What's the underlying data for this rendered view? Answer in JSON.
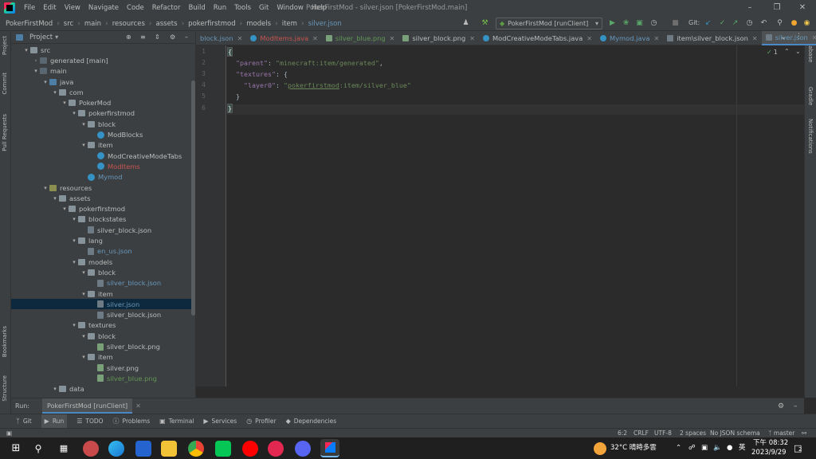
{
  "window": {
    "title": "PokerFirstMod - silver.json [PokerFirstMod.main]",
    "menus": [
      "File",
      "Edit",
      "View",
      "Navigate",
      "Code",
      "Refactor",
      "Build",
      "Run",
      "Tools",
      "Git",
      "Window",
      "Help"
    ]
  },
  "nav": {
    "breadcrumbs": [
      "PokerFirstMod",
      "src",
      "main",
      "resources",
      "assets",
      "pokerfirstmod",
      "models",
      "item",
      "silver.json"
    ],
    "run_config": "PokerFirstMod [runClient]",
    "git_label": "Git:"
  },
  "project": {
    "title": "Project",
    "tree": [
      {
        "label": "src",
        "depth": 1,
        "arrow": "v",
        "icon": "folder"
      },
      {
        "label": "generated [main]",
        "depth": 2,
        "arrow": ">",
        "icon": "gen"
      },
      {
        "label": "main",
        "depth": 2,
        "arrow": "v",
        "icon": "gen"
      },
      {
        "label": "java",
        "depth": 3,
        "arrow": "v",
        "icon": "folder-blue"
      },
      {
        "label": "com",
        "depth": 4,
        "arrow": "v",
        "icon": "folder"
      },
      {
        "label": "PokerMod",
        "depth": 5,
        "arrow": "v",
        "icon": "folder"
      },
      {
        "label": "pokerfirstmod",
        "depth": 6,
        "arrow": "v",
        "icon": "folder"
      },
      {
        "label": "block",
        "depth": 7,
        "arrow": "v",
        "icon": "folder"
      },
      {
        "label": "ModBlocks",
        "depth": 8,
        "arrow": "",
        "icon": "class"
      },
      {
        "label": "item",
        "depth": 7,
        "arrow": "v",
        "icon": "folder"
      },
      {
        "label": "ModCreativeModeTabs",
        "depth": 8,
        "arrow": "",
        "icon": "class"
      },
      {
        "label": "ModItems",
        "depth": 8,
        "arrow": "",
        "icon": "class",
        "color": "#c75450"
      },
      {
        "label": "Mymod",
        "depth": 7,
        "arrow": "",
        "icon": "class",
        "color": "#6897bb"
      },
      {
        "label": "resources",
        "depth": 3,
        "arrow": "v",
        "icon": "folder-res"
      },
      {
        "label": "assets",
        "depth": 4,
        "arrow": "v",
        "icon": "folder"
      },
      {
        "label": "pokerfirstmod",
        "depth": 5,
        "arrow": "v",
        "icon": "folder"
      },
      {
        "label": "blockstates",
        "depth": 6,
        "arrow": "v",
        "icon": "folder"
      },
      {
        "label": "silver_block.json",
        "depth": 7,
        "arrow": "",
        "icon": "json"
      },
      {
        "label": "lang",
        "depth": 6,
        "arrow": "v",
        "icon": "folder"
      },
      {
        "label": "en_us.json",
        "depth": 7,
        "arrow": "",
        "icon": "json",
        "color": "#6897bb"
      },
      {
        "label": "models",
        "depth": 6,
        "arrow": "v",
        "icon": "folder"
      },
      {
        "label": "block",
        "depth": 7,
        "arrow": "v",
        "icon": "folder"
      },
      {
        "label": "silver_block.json",
        "depth": 8,
        "arrow": "",
        "icon": "json",
        "color": "#6897bb"
      },
      {
        "label": "item",
        "depth": 7,
        "arrow": "v",
        "icon": "folder"
      },
      {
        "label": "silver.json",
        "depth": 8,
        "arrow": "",
        "icon": "json",
        "color": "#6897bb",
        "selected": true
      },
      {
        "label": "silver_block.json",
        "depth": 8,
        "arrow": "",
        "icon": "json"
      },
      {
        "label": "textures",
        "depth": 6,
        "arrow": "v",
        "icon": "folder"
      },
      {
        "label": "block",
        "depth": 7,
        "arrow": "v",
        "icon": "folder"
      },
      {
        "label": "silver_block.png",
        "depth": 8,
        "arrow": "",
        "icon": "img"
      },
      {
        "label": "item",
        "depth": 7,
        "arrow": "v",
        "icon": "folder"
      },
      {
        "label": "silver.png",
        "depth": 8,
        "arrow": "",
        "icon": "img"
      },
      {
        "label": "silver_blue.png",
        "depth": 8,
        "arrow": "",
        "icon": "img",
        "color": "#629755"
      },
      {
        "label": "data",
        "depth": 4,
        "arrow": "v",
        "icon": "folder"
      }
    ]
  },
  "tabs": [
    {
      "label": "block.json",
      "color": "#6897bb",
      "icon": "json"
    },
    {
      "label": "ModItems.java",
      "color": "#c75450",
      "icon": "class"
    },
    {
      "label": "silver_blue.png",
      "color": "#629755",
      "icon": "img"
    },
    {
      "label": "silver_block.png",
      "color": "#bbbbbb",
      "icon": "img"
    },
    {
      "label": "ModCreativeModeTabs.java",
      "color": "#bbbbbb",
      "icon": "class"
    },
    {
      "label": "Mymod.java",
      "color": "#6897bb",
      "icon": "class"
    },
    {
      "label": "item\\silver_block.json",
      "color": "#bbbbbb",
      "icon": "json"
    },
    {
      "label": "silver.json",
      "color": "#6897bb",
      "icon": "json",
      "active": true
    }
  ],
  "editor": {
    "line_numbers": [
      "1",
      "2",
      "3",
      "4",
      "5",
      "6"
    ],
    "code": {
      "l1": "{",
      "l2_key": "\"parent\"",
      "l2_sep": ": ",
      "l2_val": "\"minecraft:item/generated\"",
      "l2_end": ",",
      "l3_key": "\"textures\"",
      "l3_sep": ": {",
      "l4_key": "\"layer0\"",
      "l4_sep": ": ",
      "l4_q1": "\"",
      "l4_ns": "pokerfirstmod",
      "l4_rest": ":item/silver_blue",
      "l4_q2": "\"",
      "l5": "}",
      "l6": "}"
    },
    "inspection_count": "1"
  },
  "run_panel": {
    "label": "Run:",
    "tab": "PokerFirstMod [runClient]"
  },
  "bottom_tools": [
    "Git",
    "Run",
    "TODO",
    "Problems",
    "Terminal",
    "Services",
    "Profiler",
    "Dependencies"
  ],
  "status": {
    "position": "6:2",
    "line_sep": "CRLF",
    "encoding": "UTF-8",
    "indent": "2 spaces",
    "schema": "No JSON schema",
    "branch": "master"
  },
  "side_labels": {
    "left": [
      "Project",
      "Commit",
      "Pull Requests",
      "Bookmarks",
      "Structure"
    ],
    "right": [
      "Database",
      "Gradle",
      "Notifications"
    ]
  },
  "taskbar": {
    "weather": "32°C 晴時多雲",
    "ime": "英",
    "time": "下午 08:32",
    "date": "2023/9/29",
    "notif_count": "2"
  }
}
